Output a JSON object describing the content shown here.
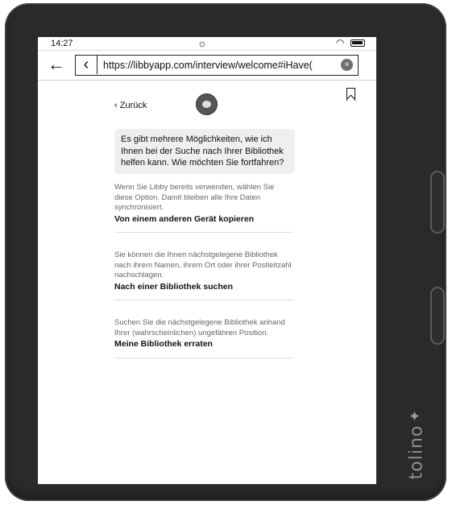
{
  "status_bar": {
    "time": "14:27"
  },
  "browser": {
    "url": "https://libbyapp.com/interview/welcome#iHave("
  },
  "page": {
    "back_label": "Zurück",
    "question": "Es gibt mehrere Möglichkeiten, wie ich Ihnen bei der Suche nach Ihrer Bibliothek helfen kann. Wie möchten Sie fortfahren?",
    "options": [
      {
        "description": "Wenn Sie Libby bereits verwenden, wählen Sie diese Option. Damit bleiben alle Ihre Daten synchronisiert.",
        "title": "Von einem anderen Gerät kopieren"
      },
      {
        "description": "Sie können die Ihnen nächstgelegene Bibliothek nach ihrem Namen, ihrem Ort oder ihrer Postleitzahl nachschlagen.",
        "title": "Nach einer Bibliothek suchen"
      },
      {
        "description": "Suchen Sie die nächstgelegene Bibliothek anhand Ihrer (wahrscheinlichen) ungefähren Position.",
        "title": "Meine Bibliothek erraten"
      }
    ]
  },
  "device": {
    "brand": "tolino"
  }
}
